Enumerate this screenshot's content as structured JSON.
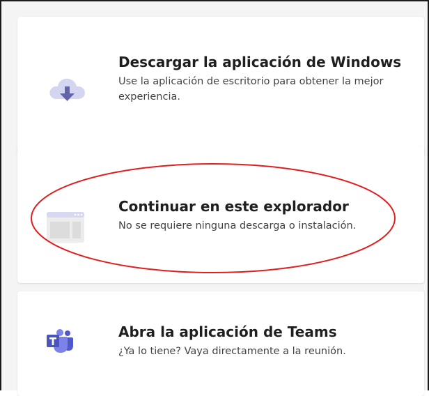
{
  "options": [
    {
      "title": "Descargar la aplicación de Windows",
      "description": "Use la aplicación de escritorio para obtener la mejor experiencia.",
      "icon": "cloud-download-icon"
    },
    {
      "title": "Continuar en este explorador",
      "description": "No se requiere ninguna descarga o instalación.",
      "icon": "browser-window-icon"
    },
    {
      "title": "Abra la aplicación de Teams",
      "description": "¿Ya lo tiene? Vaya directamente a la reunión.",
      "icon": "teams-logo-icon"
    }
  ],
  "colors": {
    "accent": "#6264a7",
    "annotation": "#e11d1d"
  }
}
